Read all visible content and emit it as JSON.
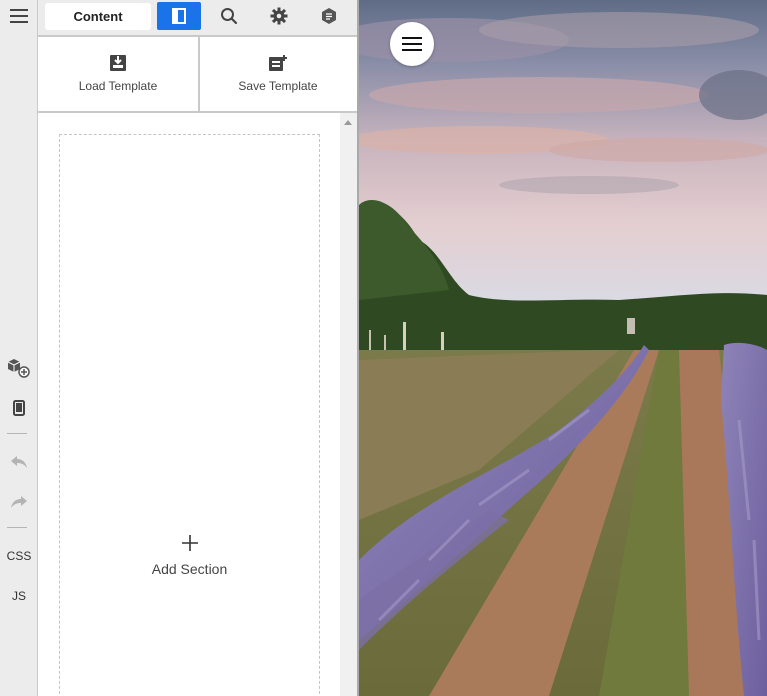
{
  "toolbar": {
    "icons": [
      "hamburger-icon",
      "add-block-icon",
      "mobile-device-icon",
      "undo-icon",
      "redo-icon"
    ],
    "css_label": "CSS",
    "js_label": "JS"
  },
  "tabs": {
    "content_label": "Content",
    "icons": [
      "layout-icon",
      "search-icon",
      "gear-icon",
      "hexagon-icon"
    ]
  },
  "templates": {
    "load_label": "Load Template",
    "save_label": "Save Template"
  },
  "canvas": {
    "add_section_label": "Add Section"
  },
  "colors": {
    "accent": "#1a73e8"
  },
  "preview": {
    "image": "lavender-field-photo",
    "menu_icon": "hamburger-icon"
  }
}
